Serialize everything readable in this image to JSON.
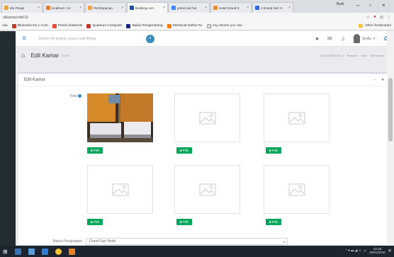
{
  "browser": {
    "tabs": [
      {
        "label": "Ide Pengir",
        "color": "#e8a33c",
        "active": false
      },
      {
        "label": "localhost / 12",
        "color": "#e57c2f",
        "active": false
      },
      {
        "label": "Perhimpunan",
        "color": "#f4a340",
        "active": false
      },
      {
        "label": "Booking.com",
        "color": "#1a4f9c",
        "active": true
      },
      {
        "label": "grand sari hot",
        "color": "#4285f4",
        "active": false
      },
      {
        "label": "Hotel Grand S",
        "color": "#f48b2a",
        "active": false
      },
      {
        "label": "3 Grand Sari H",
        "color": "#2d6bd9",
        "active": false
      }
    ],
    "profile": "Budi",
    "url": "al/kamar/edit/19",
    "bookmarks": [
      {
        "label": "Bhinneka No.1 Com",
        "color": "#c0392b"
      },
      {
        "label": "Portal Akademik",
        "color": "#e74c3c"
      },
      {
        "label": "Quantum Computer",
        "color": "#c0392b"
      },
      {
        "label": "Balian Pengembang",
        "color": "#1a237e"
      },
      {
        "label": "Membuat Daftar Ru",
        "color": "#f57c00"
      },
      {
        "label": "Any drivers you nee",
        "color": "#bbbbbb"
      }
    ],
    "other_bookmarks": "Other bookmarks"
  },
  "topnav": {
    "search_placeholder": "Search for people, places and things",
    "user_name": "Sisilia"
  },
  "header": {
    "title": "Edit Kamar",
    "subtitle": "Hotel",
    "breadcrumb": [
      "DISINI BEDISIE UI",
      "Beranda",
      "Hotel",
      "Edit Kamar"
    ]
  },
  "box": {
    "title": "Edit Kamar",
    "photo_label": "Foto",
    "photo_button_label": "Pilih",
    "photos": [
      {
        "filled": true
      },
      {
        "filled": false
      },
      {
        "filled": false
      },
      {
        "filled": false
      },
      {
        "filled": false
      },
      {
        "filled": false
      }
    ],
    "lodging_label": "Nama Penginapan",
    "lodging_value": "Grand Sari Hotel"
  },
  "taskbar": {
    "time": "15:28",
    "date": "25/01/2016"
  }
}
